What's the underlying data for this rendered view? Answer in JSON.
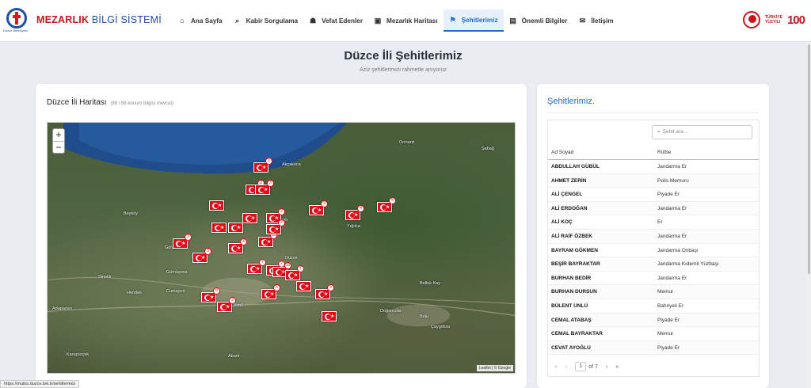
{
  "brand": {
    "title_bold": "MEZARLIK",
    "title_rest": " BİLGİ SİSTEMİ",
    "logo_caption": "Düzce Belediyesi"
  },
  "nav": [
    {
      "label": "Ana Sayfa",
      "icon": "home-icon",
      "glyph": "⌂"
    },
    {
      "label": "Kabir Sorgulama",
      "icon": "search-icon",
      "glyph": "⌕"
    },
    {
      "label": "Vefat Edenler",
      "icon": "users-icon",
      "glyph": "☗"
    },
    {
      "label": "Mezarlık Haritası",
      "icon": "map-icon",
      "glyph": "▣"
    },
    {
      "label": "Şehitlerimiz",
      "icon": "flag-icon",
      "glyph": "⚑",
      "active": true
    },
    {
      "label": "Önemli Bilgiler",
      "icon": "book-icon",
      "glyph": "▤"
    },
    {
      "label": "İletişim",
      "icon": "mail-icon",
      "glyph": "✉"
    }
  ],
  "right_logos": {
    "turkiye_text": "TÜRKİYE YÜZYILI",
    "centenary": "100"
  },
  "header": {
    "title": "Düzce İli Şehitlerimiz",
    "subtitle": "Aziz şehitlerimizi rahmetle anıyoruz"
  },
  "map_card": {
    "title": "Düzce İli Haritası",
    "count_note": "(88 / 88 konum bilgisi mevcut)",
    "zoom_in": "+",
    "zoom_out": "−",
    "attribution": "Leaflet | © Google",
    "places": [
      "Akçakoca",
      "Kaynaşlı",
      "Gölyaka",
      "Gümüşova",
      "Cumayeri",
      "Yığılca",
      "Çilimli",
      "Düzce",
      "Bolu",
      "Hendek",
      "Karapürçek",
      "Adapazarı",
      "Şabağ",
      "Ormanlı",
      "Doğancılar",
      "Sinekli",
      "Bolluk Kay",
      "Beyköy",
      "Çaygöksu",
      "Abant"
    ],
    "markers": [
      {
        "num": "1"
      },
      {
        "num": "2"
      },
      {
        "num": "2"
      },
      {
        "num": "3"
      },
      {
        "num": "4"
      },
      {
        "num": "5"
      },
      {
        "num": "2"
      },
      {
        "num": "3"
      },
      {
        "num": "4"
      },
      {
        "num": "10"
      },
      {
        "num": "2"
      },
      {
        "num": "7"
      },
      {
        "num": "2"
      },
      {
        "num": "15"
      },
      {
        "num": "7"
      },
      {
        "num": "5"
      },
      {
        "num": "8"
      },
      {
        "num": "2"
      },
      {
        "num": "5"
      },
      {
        "num": "3"
      },
      {
        "num": ""
      },
      {
        "num": ""
      },
      {
        "num": ""
      },
      {
        "num": ""
      },
      {
        "num": ""
      },
      {
        "num": ""
      }
    ]
  },
  "list_card": {
    "title": "Şehitlerimiz.",
    "search_placeholder": "Şehit ara...",
    "col_name": "Ad Soyad",
    "col_rank": "Rütbe",
    "rows": [
      {
        "name": "ABDULLAH GÜBÜL",
        "rank": "Jandarma Er"
      },
      {
        "name": "AHMET ZERİN",
        "rank": "Polis Memuru"
      },
      {
        "name": "ALİ ÇENGEL",
        "rank": "Piyade Er"
      },
      {
        "name": "ALİ ERDOĞAN",
        "rank": "Jandarma Er"
      },
      {
        "name": "ALİ KOÇ",
        "rank": "Er"
      },
      {
        "name": "ALİ RAİF ÖZBEK",
        "rank": "Jandarma Er"
      },
      {
        "name": "BAYRAM GÖKMEN",
        "rank": "Jandarma Onbaşı"
      },
      {
        "name": "BEŞİR BAYRAKTAR",
        "rank": "Jandarma Kıdemli Yüzbaşı"
      },
      {
        "name": "BURHAN BEDİR",
        "rank": "Jandarma Er"
      },
      {
        "name": "BURHAN DURSUN",
        "rank": "Memur"
      },
      {
        "name": "BÜLENT ÜNLÜ",
        "rank": "Bahriyeli Er"
      },
      {
        "name": "CEMAL ATABAŞ",
        "rank": "Piyade Er"
      },
      {
        "name": "CEMAL BAYRAKTAR",
        "rank": "Memur"
      },
      {
        "name": "CEVAT AYOĞLU",
        "rank": "Piyade Er"
      }
    ],
    "pager": {
      "first": "«",
      "prev": "‹",
      "page": "1",
      "of": "of 7",
      "next": "›",
      "last": "»"
    }
  },
  "status_url": "https://mubis.duzce.bel.tr/sehitlerimiz"
}
